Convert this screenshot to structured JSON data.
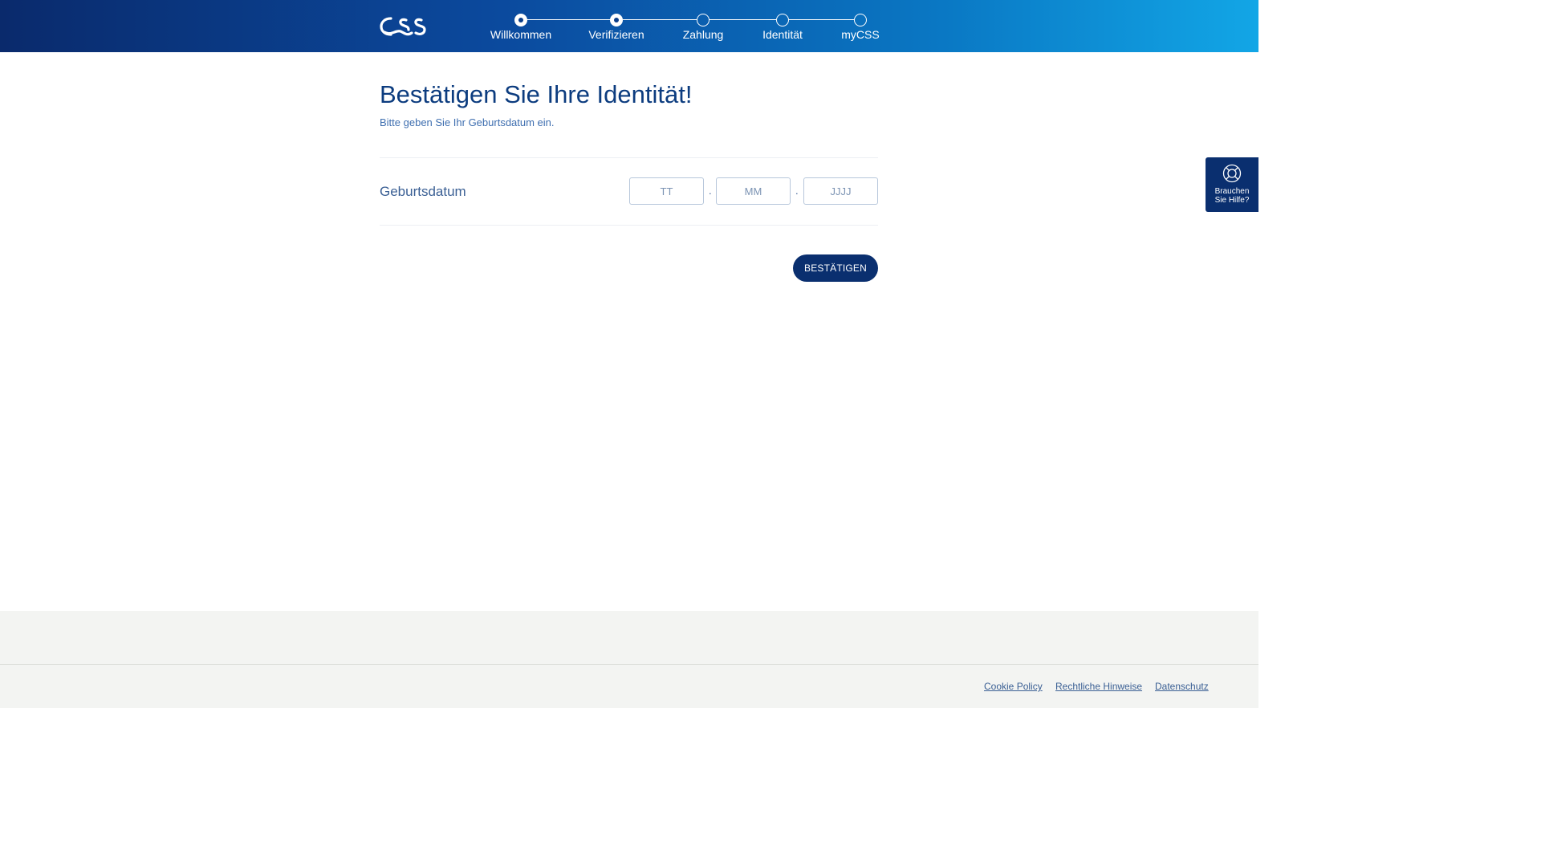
{
  "header": {
    "logo_alt": "CSS",
    "steps": [
      {
        "label": "Willkommen",
        "state": "done"
      },
      {
        "label": "Verifizieren",
        "state": "done"
      },
      {
        "label": "Zahlung",
        "state": "open"
      },
      {
        "label": "Identität",
        "state": "open"
      },
      {
        "label": "myCSS",
        "state": "open"
      }
    ]
  },
  "main": {
    "title": "Bestätigen Sie Ihre Identität!",
    "subtitle": "Bitte geben Sie Ihr Geburtsdatum ein.",
    "birthdate": {
      "label": "Geburtsdatum",
      "day_placeholder": "TT",
      "month_placeholder": "MM",
      "year_placeholder": "JJJJ",
      "separator": ".",
      "day_value": "",
      "month_value": "",
      "year_value": ""
    },
    "confirm_label": "BESTÄTIGEN"
  },
  "help": {
    "icon": "lifebuoy-icon",
    "line1": "Brauchen",
    "line2": "Sie Hilfe?"
  },
  "footer": {
    "links": [
      "Cookie Policy",
      "Rechtliche Hinweise",
      "Datenschutz"
    ]
  },
  "colors": {
    "brand_dark": "#0a2f6f",
    "brand_title": "#0c3c7f",
    "header_gradient_start": "#0a2a6c",
    "header_gradient_end": "#12a6e6",
    "footer_bg": "#f3f4f2"
  }
}
